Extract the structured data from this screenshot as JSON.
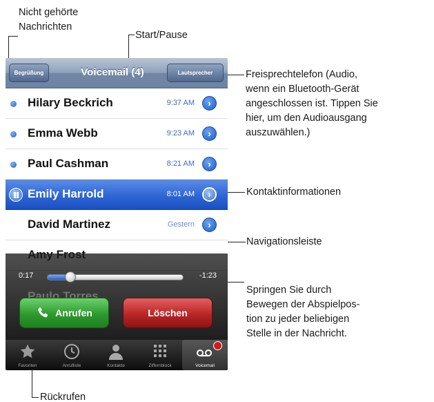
{
  "callouts": {
    "unheard": [
      "Nicht gehörte",
      "Nachrichten"
    ],
    "play_pause": "Start/Pause",
    "speaker": [
      "Freisprechtelefon (Audio,",
      "wenn ein Bluetooth-Gerät",
      "angeschlossen ist. Tippen Sie",
      "hier, um den Audioausgang",
      "auszuwählen.)"
    ],
    "contact_info": "Kontaktinformationen",
    "scrubber": "Navigationsleiste",
    "drag": [
      "Springen Sie durch",
      "Bewegen der Abspielpos-",
      "tion zu jeder beliebigen",
      "Stelle in der Nachricht."
    ],
    "call_back": "Rückrufen"
  },
  "navbar": {
    "left_button": "Begrüßung",
    "title": "Voicemail (4)",
    "right_button": "Lautsprecher"
  },
  "messages": [
    {
      "name": "Hilary Beckrich",
      "time": "9:37 AM",
      "unheard": true
    },
    {
      "name": "Emma Webb",
      "time": "9:23 AM",
      "unheard": true
    },
    {
      "name": "Paul Cashman",
      "time": "8:21 AM",
      "unheard": true
    },
    {
      "name": "Emily Harrold",
      "time": "8:01 AM",
      "unheard": false,
      "playing": true
    },
    {
      "name": "David Martinez",
      "time": "Gestern",
      "unheard": false
    },
    {
      "name": "Amy Frost",
      "time": "",
      "unheard": false
    },
    {
      "name": "Paulo Torres",
      "time": "",
      "unheard": false
    }
  ],
  "player": {
    "elapsed": "0:17",
    "remaining": "-1:23",
    "progress": 0.17,
    "call_button": "Anrufen",
    "delete_button": "Löschen"
  },
  "tabs": [
    {
      "label": "Favoriten",
      "icon": "star-icon"
    },
    {
      "label": "Anrufliste",
      "icon": "clock-icon"
    },
    {
      "label": "Kontakte",
      "icon": "person-icon"
    },
    {
      "label": "Ziffernblock",
      "icon": "keypad-icon"
    },
    {
      "label": "Voicemail",
      "icon": "voicemail-icon",
      "selected": true
    }
  ],
  "colors": {
    "accent_blue": "#2c63d2",
    "call_green": "#2e9a2e",
    "delete_red": "#b92626",
    "badge_red": "#d21a1a"
  }
}
